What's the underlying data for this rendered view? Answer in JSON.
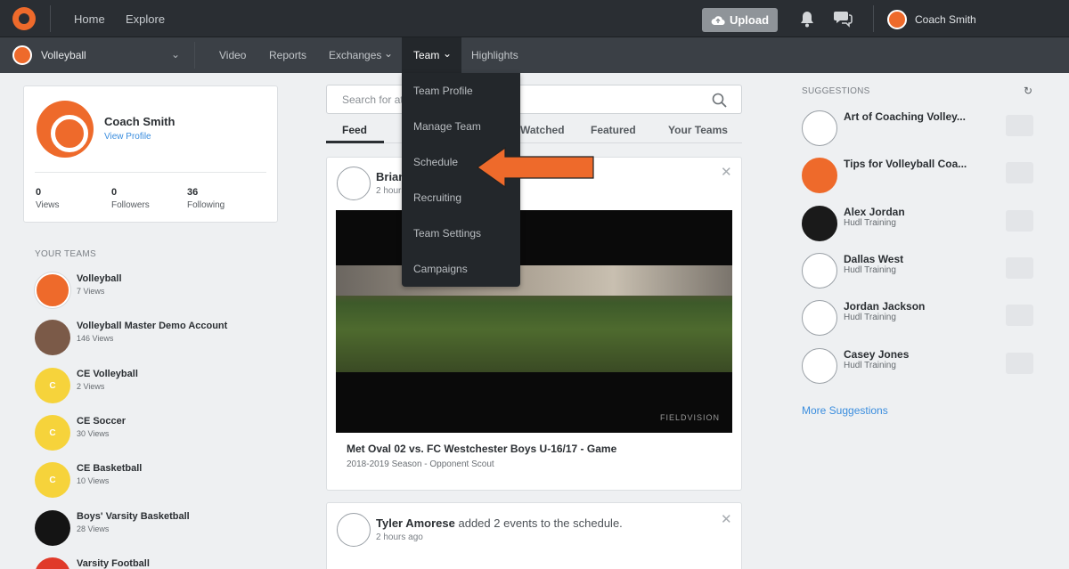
{
  "topbar": {
    "nav": [
      "Home",
      "Explore"
    ],
    "upload_label": "Upload",
    "user_name": "Coach Smith"
  },
  "subbar": {
    "team_name": "Volleyball",
    "nav": [
      "Video",
      "Reports",
      "Exchanges",
      "Team",
      "Highlights"
    ]
  },
  "team_menu": {
    "items": [
      "Team Profile",
      "Manage Team",
      "Schedule",
      "Recruiting",
      "Team Settings",
      "Campaigns"
    ]
  },
  "profile": {
    "name": "Coach Smith",
    "link": "View Profile",
    "stats": [
      {
        "value": "0",
        "label": "Views"
      },
      {
        "value": "0",
        "label": "Followers"
      },
      {
        "value": "36",
        "label": "Following"
      }
    ]
  },
  "your_teams": {
    "heading": "YOUR TEAMS",
    "items": [
      {
        "name": "Volleyball",
        "views": "7 Views",
        "avatar": "orange",
        "initial": ""
      },
      {
        "name": "Volleyball Master Demo Account",
        "views": "146 Views",
        "avatar": "photo",
        "initial": ""
      },
      {
        "name": "CE Volleyball",
        "views": "2 Views",
        "avatar": "yellow",
        "initial": "C"
      },
      {
        "name": "CE Soccer",
        "views": "30 Views",
        "avatar": "yellow",
        "initial": "C"
      },
      {
        "name": "CE Basketball",
        "views": "10 Views",
        "avatar": "yellow",
        "initial": "C"
      },
      {
        "name": "Boys' Varsity Basketball",
        "views": "28 Views",
        "avatar": "black",
        "initial": ""
      },
      {
        "name": "Varsity Football",
        "views": "",
        "avatar": "red",
        "initial": ""
      }
    ]
  },
  "feed": {
    "search_placeholder": "Search for at...",
    "tabs": [
      "Feed",
      "Watched",
      "Featured",
      "Your Teams"
    ],
    "posts": [
      {
        "name": "Brian",
        "action": "",
        "time": "2 hours"
      },
      {
        "name": "Tyler Amorese",
        "action": " added 2 events to the schedule.",
        "time": "2 hours ago"
      }
    ],
    "video": {
      "watermark": "FIELDVISION",
      "title": "Met Oval 02 vs. FC Westchester Boys U-16/17 - Game",
      "subtitle": "2018-2019 Season - Opponent Scout"
    }
  },
  "suggestions": {
    "heading": "SUGGESTIONS",
    "items": [
      {
        "name": "Art of Coaching Volley...",
        "sub": ""
      },
      {
        "name": "Tips for Volleyball Coa...",
        "sub": ""
      },
      {
        "name": "Alex Jordan",
        "sub": "Hudl Training"
      },
      {
        "name": "Dallas West",
        "sub": "Hudl Training"
      },
      {
        "name": "Jordan Jackson",
        "sub": "Hudl Training"
      },
      {
        "name": "Casey Jones",
        "sub": "Hudl Training"
      }
    ],
    "more": "More Suggestions"
  },
  "colors": {
    "brand": "#ee6a2b",
    "link": "#3a8dde",
    "topbar": "#2a2e33"
  }
}
